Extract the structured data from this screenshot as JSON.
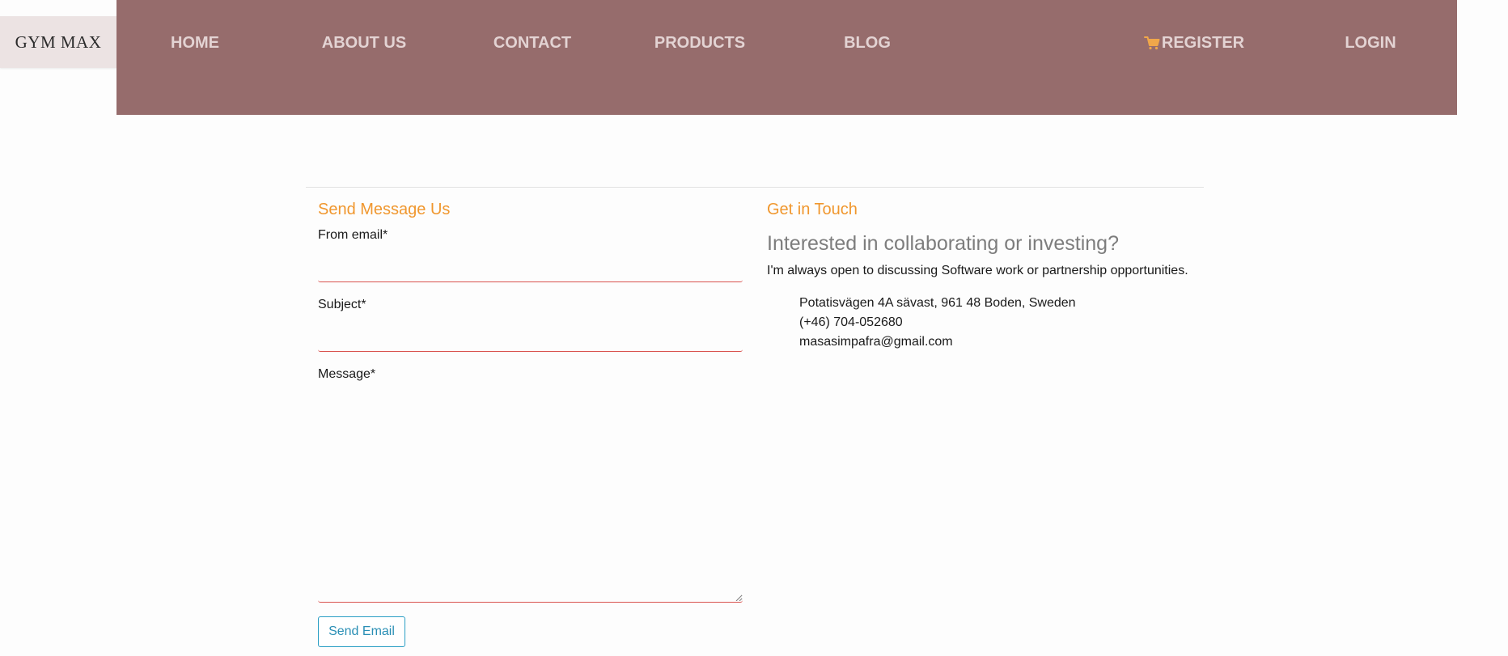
{
  "brand": {
    "name": "GYM MAX"
  },
  "nav": {
    "items": [
      {
        "label": "HOME"
      },
      {
        "label": "ABOUT US"
      },
      {
        "label": "CONTACT"
      },
      {
        "label": "PRODUCTS"
      },
      {
        "label": "BLOG"
      },
      {
        "label": "REGISTER"
      },
      {
        "label": "LOGIN"
      }
    ],
    "cart_icon": "shopping-cart-icon"
  },
  "colors": {
    "navbar": "#966c6c",
    "nav_text": "#e3d3d3",
    "accent": "#f0972e",
    "input_border": "#d9534f",
    "button": "#2a9ec4"
  },
  "form": {
    "title": "Send Message Us",
    "email_label": "From email*",
    "email_value": "",
    "subject_label": "Subject*",
    "subject_value": "",
    "message_label": "Message*",
    "message_value": "",
    "submit_label": "Send Email"
  },
  "contact": {
    "title": "Get in Touch",
    "heading": "Interested in collaborating or investing?",
    "text": "I'm always open to discussing Software work or partnership opportunities.",
    "address": "Potatisvägen 4A sävast, 961 48 Boden, Sweden",
    "phone": "(+46) 704-052680",
    "email": "masasimpafra@gmail.com"
  }
}
